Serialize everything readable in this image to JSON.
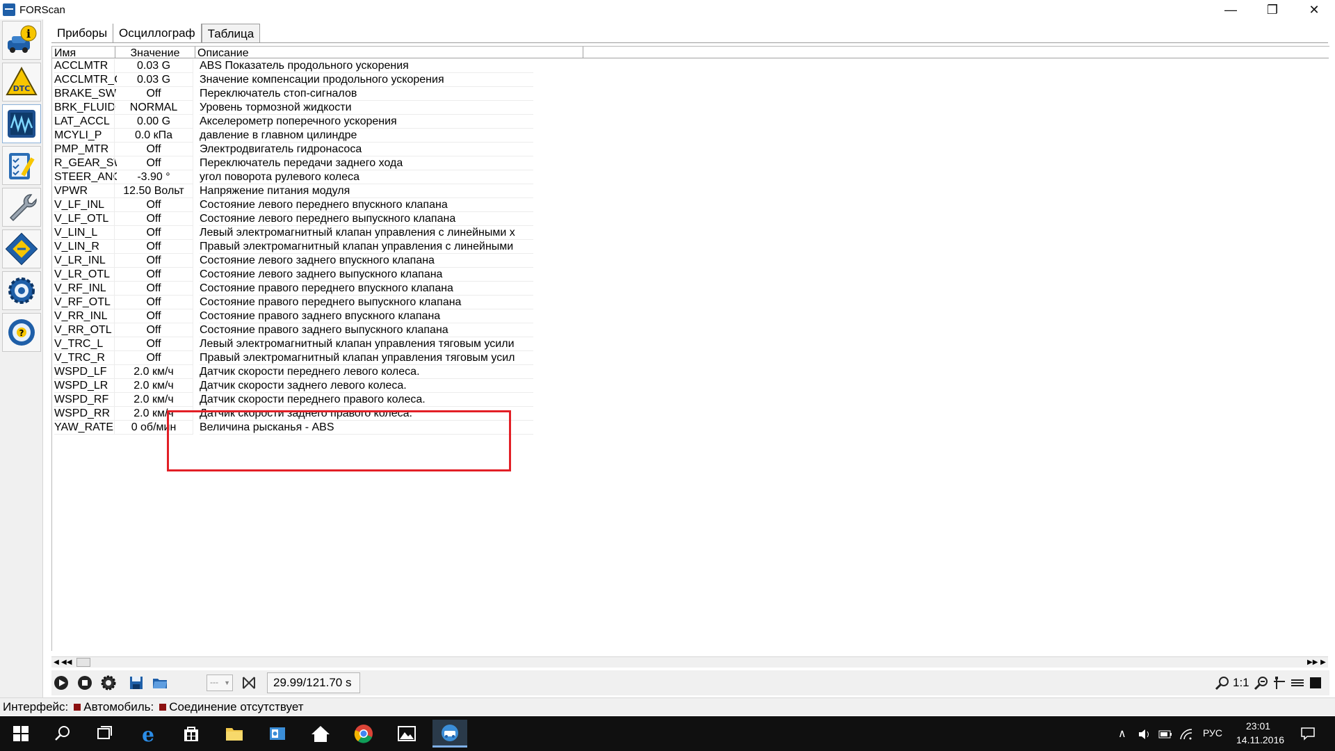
{
  "window": {
    "title": "FORScan",
    "minimize_glyph": "—",
    "maximize_glyph": "❐",
    "close_glyph": "✕"
  },
  "sidebar": {
    "items": [
      {
        "name": "vehicle-info",
        "icon": "car-info-icon"
      },
      {
        "name": "dtc",
        "icon": "dtc-warning-icon",
        "label": "DTC"
      },
      {
        "name": "oscilloscope",
        "icon": "oscilloscope-icon"
      },
      {
        "name": "tests",
        "icon": "checklist-icon"
      },
      {
        "name": "service",
        "icon": "wrench-icon"
      },
      {
        "name": "configuration",
        "icon": "chip-icon"
      },
      {
        "name": "settings",
        "icon": "gear-icon"
      },
      {
        "name": "help",
        "icon": "help-icon"
      }
    ]
  },
  "tabs": [
    {
      "label": "Приборы"
    },
    {
      "label": "Осциллограф"
    },
    {
      "label": "Таблица"
    }
  ],
  "table": {
    "headers": [
      "Имя",
      "Значение",
      "Описание"
    ],
    "rows": [
      {
        "name": "ACCLMTR",
        "value": "0.03 G",
        "desc": "ABS Показатель продольного ускорения"
      },
      {
        "name": "ACCLMTR_C",
        "value": "0.03 G",
        "desc": "Значение компенсации продольного ускорения"
      },
      {
        "name": "BRAKE_SW",
        "value": "Off",
        "desc": "Переключатель стоп-сигналов"
      },
      {
        "name": "BRK_FLUID",
        "value": "NORMAL",
        "desc": "Уровень тормозной жидкости"
      },
      {
        "name": "LAT_ACCL",
        "value": "0.00 G",
        "desc": "Акселерометр поперечного ускорения"
      },
      {
        "name": "MCYLI_P",
        "value": "0.0 кПа",
        "desc": "давление в главном цилиндре"
      },
      {
        "name": "PMP_MTR",
        "value": "Off",
        "desc": "Электродвигатель гидронасоса"
      },
      {
        "name": "R_GEAR_SW",
        "value": "Off",
        "desc": "Переключатель передачи заднего хода"
      },
      {
        "name": "STEER_ANG",
        "value": "-3.90 °",
        "desc": "угол поворота рулевого колеса"
      },
      {
        "name": "VPWR",
        "value": "12.50 Вольт",
        "desc": "Напряжение питания модуля"
      },
      {
        "name": "V_LF_INL",
        "value": "Off",
        "desc": "Состояние левого переднего впускного клапана"
      },
      {
        "name": "V_LF_OTL",
        "value": "Off",
        "desc": "Состояние левого переднего выпускного клапана"
      },
      {
        "name": "V_LIN_L",
        "value": "Off",
        "desc": "Левый электромагнитный клапан управления с линейными х"
      },
      {
        "name": "V_LIN_R",
        "value": "Off",
        "desc": "Правый электромагнитный клапан управления с линейными"
      },
      {
        "name": "V_LR_INL",
        "value": "Off",
        "desc": "Состояние левого заднего впускного клапана"
      },
      {
        "name": "V_LR_OTL",
        "value": "Off",
        "desc": "Состояние левого заднего выпускного клапана"
      },
      {
        "name": "V_RF_INL",
        "value": "Off",
        "desc": "Состояние правого переднего впускного клапана"
      },
      {
        "name": "V_RF_OTL",
        "value": "Off",
        "desc": "Состояние правого переднего выпускного клапана"
      },
      {
        "name": "V_RR_INL",
        "value": "Off",
        "desc": "Состояние правого заднего впускного клапана"
      },
      {
        "name": "V_RR_OTL",
        "value": "Off",
        "desc": "Состояние правого заднего выпускного клапана"
      },
      {
        "name": "V_TRC_L",
        "value": "Off",
        "desc": "Левый электромагнитный клапан управления тяговым усили"
      },
      {
        "name": "V_TRC_R",
        "value": "Off",
        "desc": "Правый электромагнитный клапан управления тяговым усил"
      },
      {
        "name": "WSPD_LF",
        "value": "2.0 км/ч",
        "desc": "Датчик скорости переднего левого колеса."
      },
      {
        "name": "WSPD_LR",
        "value": "2.0 км/ч",
        "desc": "Датчик скорости заднего левого колеса."
      },
      {
        "name": "WSPD_RF",
        "value": "2.0 км/ч",
        "desc": "Датчик скорости переднего правого колеса."
      },
      {
        "name": "WSPD_RR",
        "value": "2.0 км/ч",
        "desc": "Датчик скорости заднего правого колеса."
      },
      {
        "name": "YAW_RATE",
        "value": "0 об/мин",
        "desc": "Величина рысканья - ABS"
      }
    ]
  },
  "toolbar": {
    "combo_value": "---",
    "time": "29.99/121.70 s",
    "zoom_label": "1:1"
  },
  "status": {
    "interface_label": "Интерфейс:",
    "vehicle_label": "Автомобиль:",
    "connection_text": "Соединение отсутствует",
    "indicator_color": "#8b1010"
  },
  "taskbar": {
    "language": "РУС",
    "time": "23:01",
    "date": "14.11.2016"
  },
  "colors": {
    "highlight": "#e21f26",
    "accent": "#1f5fa8"
  }
}
